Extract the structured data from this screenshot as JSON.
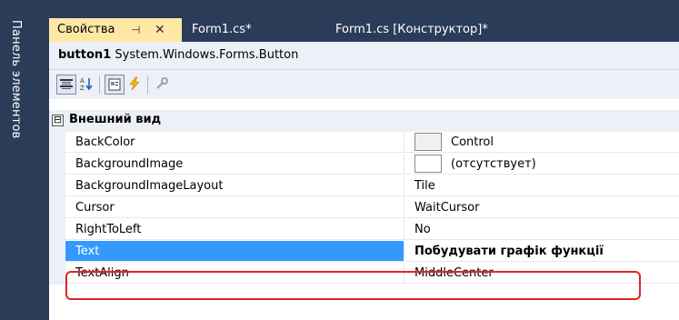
{
  "side_panel": {
    "label": "Панель элементов"
  },
  "tabs": [
    {
      "label": "Свойства",
      "pin": "⊣",
      "close": "✕",
      "active": true
    },
    {
      "label": "Form1.cs*"
    },
    {
      "label": "Form1.cs [Конструктор]*"
    }
  ],
  "object_selector": {
    "name": "button1",
    "type": "System.Windows.Forms.Button"
  },
  "toolbar": {
    "icons": [
      "categorized-icon",
      "alphabetical-icon",
      "properties-icon",
      "events-icon",
      "property-pages-icon"
    ]
  },
  "category": {
    "toggle": "⊟",
    "label": "Внешний вид"
  },
  "properties": [
    {
      "name": "BackColor",
      "value": "Control",
      "swatch": "#f0f0f0"
    },
    {
      "name": "BackgroundImage",
      "value": "(отсутствует)",
      "swatch": "#ffffff"
    },
    {
      "name": "BackgroundImageLayout",
      "value": "Tile"
    },
    {
      "name": "Cursor",
      "value": "WaitCursor"
    },
    {
      "name": "RightToLeft",
      "value": "No"
    },
    {
      "name": "Text",
      "value": "Побудувати графік функції",
      "selected": true
    },
    {
      "name": "TextAlign",
      "value": "MiddleCenter"
    }
  ],
  "colors": {
    "accent_tab": "#ffe8a6",
    "selection": "#3399ff",
    "highlight": "#e0242b",
    "chrome": "#2b3c59"
  }
}
